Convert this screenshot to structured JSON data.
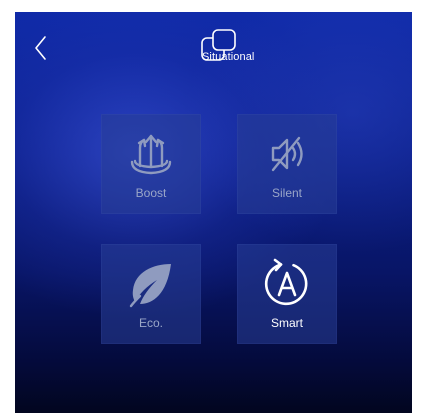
{
  "header": {
    "title": "Situational",
    "title_icon": "situational-icon"
  },
  "navigation": {
    "back_icon": "chevron-left-icon"
  },
  "modes": [
    {
      "label": "Boost",
      "icon": "boost-arrows-icon",
      "active": false
    },
    {
      "label": "Silent",
      "icon": "speaker-mute-icon",
      "active": false
    },
    {
      "label": "Eco.",
      "icon": "leaf-icon",
      "active": false
    },
    {
      "label": "Smart",
      "icon": "auto-a-icon",
      "active": true
    }
  ],
  "colors": {
    "background_top": "#0f2aa8",
    "background_bottom": "#02061f",
    "tile_bg": "#283e96",
    "icon_inactive": "#8f9bbf",
    "icon_active": "#ffffff"
  }
}
